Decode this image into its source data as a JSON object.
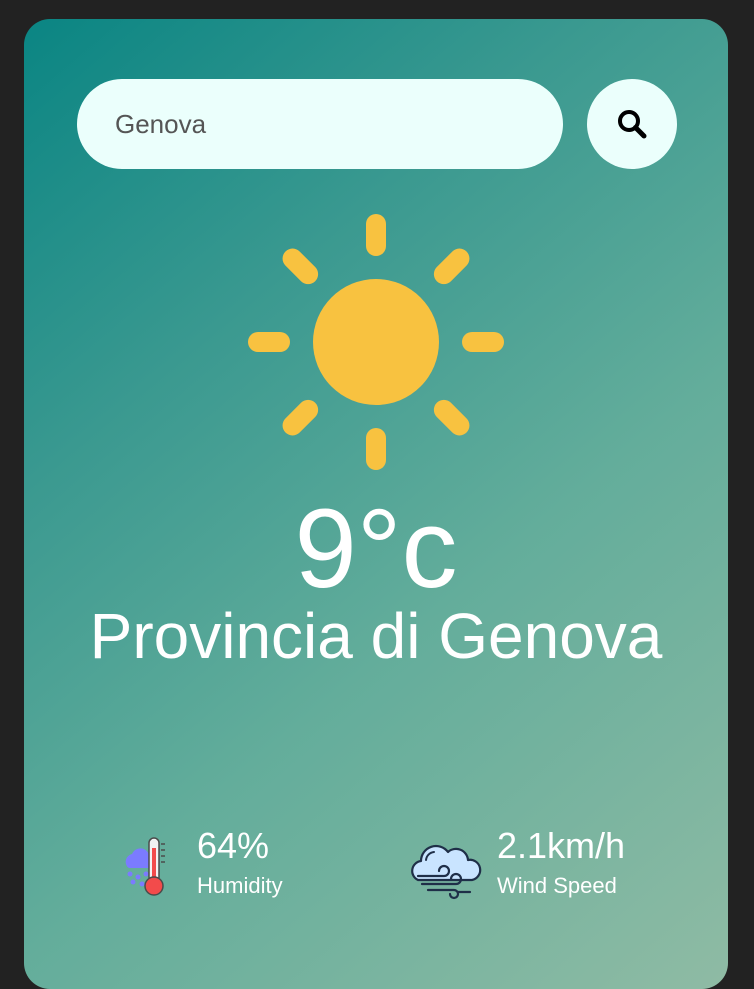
{
  "search": {
    "value": "Genova",
    "icon": "search-icon"
  },
  "weather": {
    "icon": "sun-icon",
    "temperature": "9°c",
    "city": "Provincia di Genova"
  },
  "details": {
    "humidity": {
      "icon": "humidity-thermometer-icon",
      "value": "64%",
      "label": "Humidity"
    },
    "wind": {
      "icon": "wind-cloud-icon",
      "value": "2.1km/h",
      "label": "Wind Speed"
    }
  },
  "colors": {
    "background": "#222222",
    "gradient_start": "#0a8583",
    "gradient_end": "#8fbba4",
    "input_bg": "#ebfffc",
    "sun": "#f8c240"
  }
}
